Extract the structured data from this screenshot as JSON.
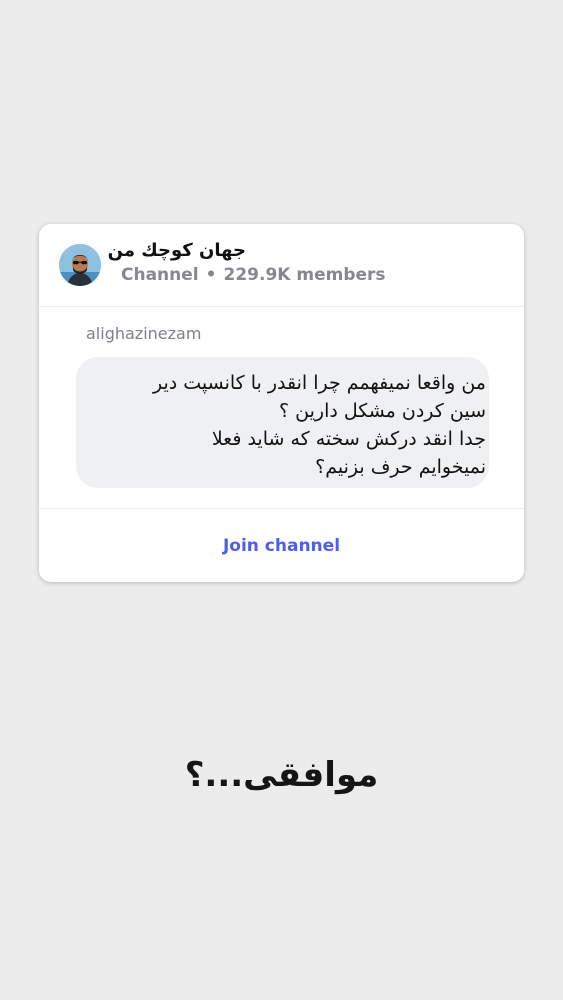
{
  "card": {
    "channel_name": "جهان کوچك من",
    "channel_type": "Channel",
    "separator": "•",
    "members": "229.9K members",
    "author": "alighazinezam",
    "message_lines": [
      "من واقعا نمیفهمم چرا انقدر با کانسپت دیر",
      "سین کردن مشکل دارین ؟",
      "جدا انقد درکش سخته که شاید فعلا",
      "نمیخوایم حرف بزنیم؟"
    ],
    "join_label": "Join channel"
  },
  "caption": "موافقی...؟",
  "colors": {
    "background": "#ececec",
    "card": "#ffffff",
    "bubble": "#eff0f2",
    "accent": "#4f5ee6",
    "muted_text": "#85888e"
  },
  "icons": {
    "avatar": "profile-photo"
  }
}
